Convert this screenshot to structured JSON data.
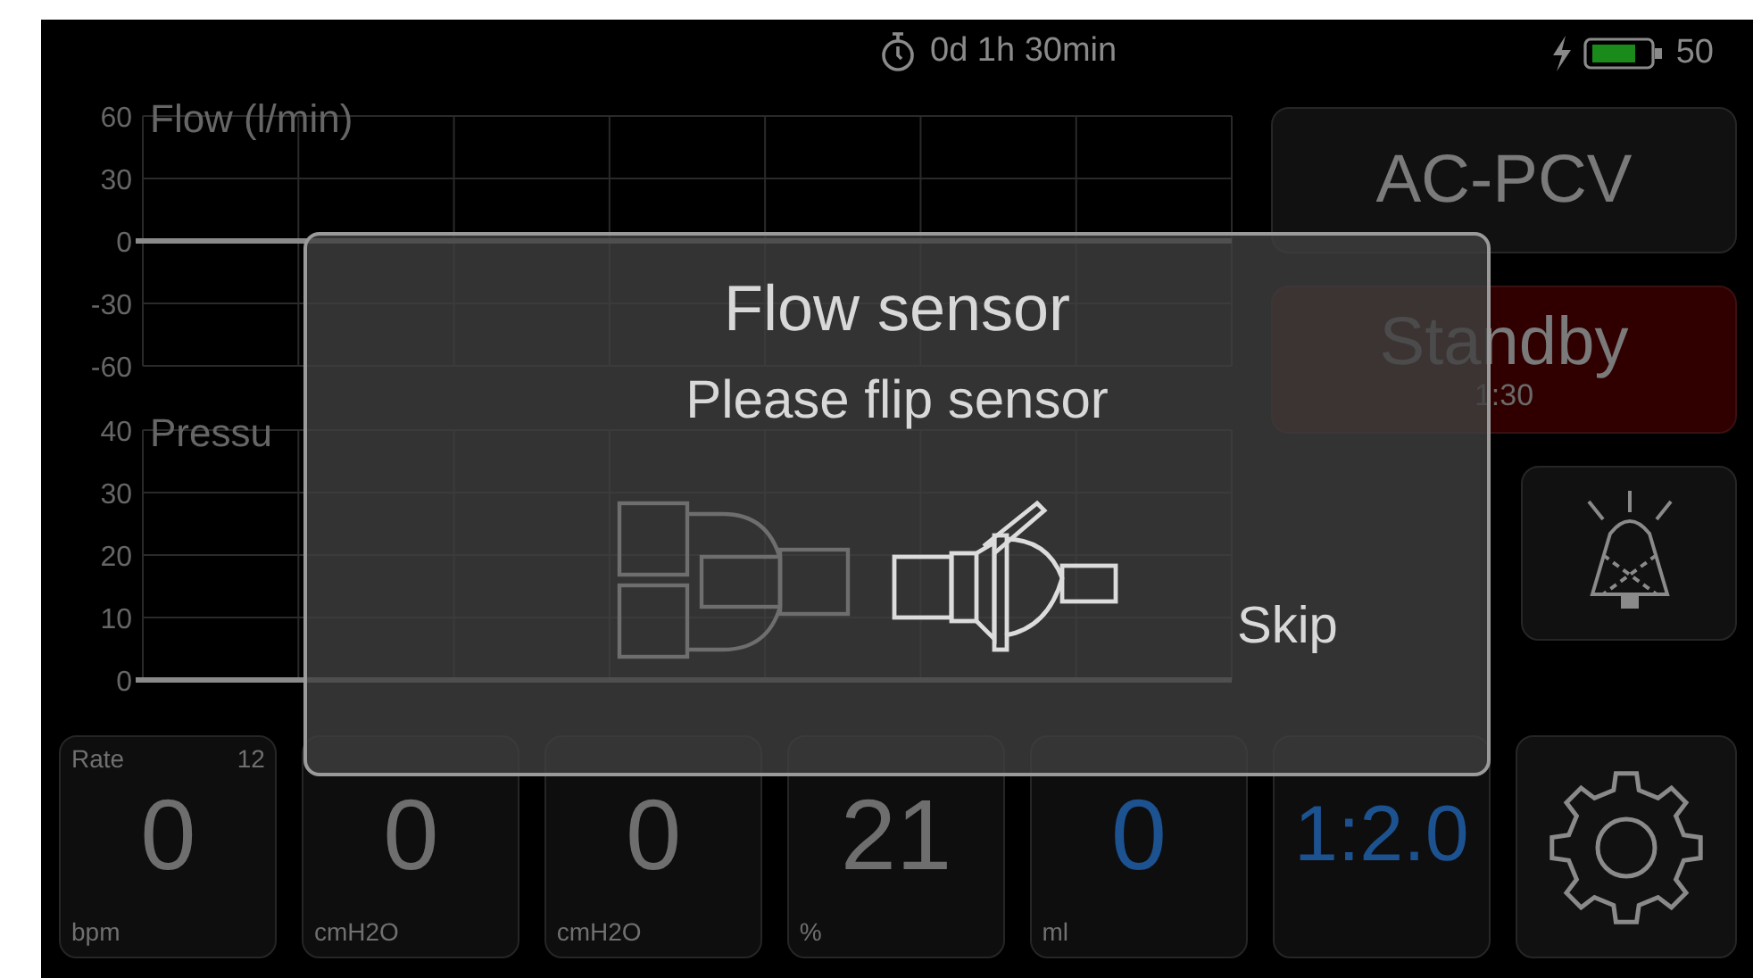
{
  "status_bar": {
    "timer": "0d 1h 30min",
    "battery": "50"
  },
  "charts": [
    {
      "title": "Flow (l/min)",
      "y_labels": [
        "60",
        "30",
        "0",
        "-30",
        "-60"
      ]
    },
    {
      "title": "Pressu",
      "y_labels": [
        "40",
        "30",
        "20",
        "10",
        "0"
      ]
    }
  ],
  "mode_button": {
    "label": "AC-PCV"
  },
  "standby_button": {
    "label": "Standby",
    "time": "1:30"
  },
  "tiles": [
    {
      "label": "Rate",
      "setting": "12",
      "value": "0",
      "unit": "bpm",
      "color": "#6e6e6e"
    },
    {
      "value": "0",
      "unit": "cmH2O",
      "color": "#6e6e6e"
    },
    {
      "value": "0",
      "unit": "cmH2O",
      "color": "#6e6e6e"
    },
    {
      "value": "21",
      "unit": "%",
      "color": "#6e6e6e"
    },
    {
      "value": "0",
      "unit": "ml",
      "color": "#1d5290"
    },
    {
      "value": "1:2.0",
      "color": "#1d5290"
    }
  ],
  "dialog": {
    "title": "Flow sensor",
    "message": "Please flip sensor",
    "skip": "Skip"
  }
}
